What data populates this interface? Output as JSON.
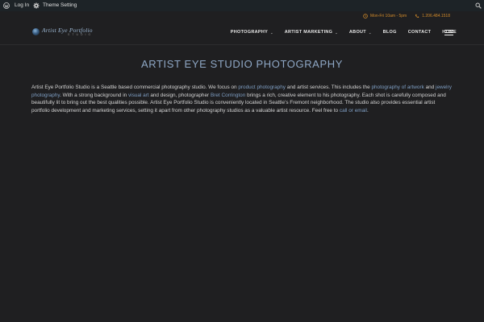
{
  "adminbar": {
    "login_label": "Log In",
    "theme_label": "Theme Setting"
  },
  "info": {
    "hours": "Mon-Fri 10am - 5pm",
    "phone": "1.206.484.1518"
  },
  "logo": {
    "name": "Artist Eye Portfolio",
    "sub": "STUDIO"
  },
  "nav": {
    "items": [
      {
        "label": "PHOTOGRAPHY",
        "dropdown": true
      },
      {
        "label": "ARTIST MARKETING",
        "dropdown": true
      },
      {
        "label": "ABOUT",
        "dropdown": true
      },
      {
        "label": "BLOG",
        "dropdown": false
      },
      {
        "label": "CONTACT",
        "dropdown": false
      },
      {
        "label": "HOME",
        "dropdown": false
      }
    ],
    "caret": "⌄"
  },
  "page": {
    "title": "ARTIST EYE STUDIO PHOTOGRAPHY",
    "p": {
      "t1": "Artist Eye Portfolio Studio is a Seattle based commercial photography studio. We focus on ",
      "l1": "product photography",
      "t2": " and artist services. This includes the ",
      "l2": "photography of artwork",
      "t3": " and ",
      "l3": "jewelry photography",
      "t4": ". With a strong background in ",
      "l4": "visual art",
      "t5": " and design, photographer ",
      "l5": "Bret Corrington",
      "t6": " brings a rich, creative element to his photography. Each shot is carefully composed and beautifully lit to bring out the best qualities possible. Artist Eye Portfolio Studio is conveniently located in Seattle’s Fremont neighborhood.  The studio also provides essential artist portfolio development and marketing services, setting it apart from other photography studios as a valuable artist resource. Feel free to ",
      "l6": "call or email",
      "t7": "."
    }
  },
  "colors": {
    "background": "#1f1f21",
    "accent": "#d08a2a",
    "link": "#7f9fc4",
    "title": "#8fa8c6"
  }
}
